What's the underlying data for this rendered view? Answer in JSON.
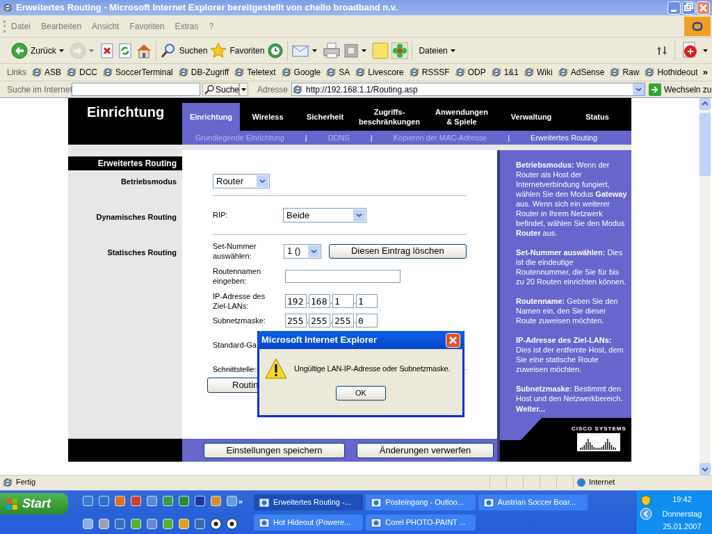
{
  "window": {
    "title": "Erweitertes Routing - Microsoft Internet Explorer bereitgestellt von chello broadband n.v."
  },
  "menu": [
    "Datei",
    "Bearbeiten",
    "Ansicht",
    "Favoriten",
    "Extras",
    "?"
  ],
  "toolbar_groups": [
    [
      {
        "kind": "back",
        "label": "Zurück",
        "dropdown": true,
        "disabled": false
      },
      {
        "kind": "forward",
        "dropdown": true,
        "disabled": true
      },
      {
        "kind": "stop",
        "dropdown": false,
        "disabled": false
      },
      {
        "kind": "refresh",
        "dropdown": false,
        "disabled": false
      },
      {
        "kind": "home",
        "dropdown": false,
        "disabled": false
      }
    ],
    [
      {
        "kind": "search",
        "label": "Suchen",
        "dropdown": false,
        "disabled": false
      },
      {
        "kind": "favorites",
        "label": "Favoriten",
        "dropdown": false,
        "disabled": false
      },
      {
        "kind": "history",
        "dropdown": false,
        "disabled": false
      }
    ],
    [
      {
        "kind": "mail",
        "dropdown": true,
        "disabled": false
      },
      {
        "kind": "print",
        "dropdown": false,
        "disabled": false
      },
      {
        "kind": "edit",
        "dropdown": true,
        "disabled": false
      },
      {
        "kind": "note",
        "dropdown": false,
        "disabled": false
      },
      {
        "kind": "flower",
        "dropdown": false,
        "disabled": false
      }
    ],
    [
      {
        "kind": "text",
        "label": "Dateien",
        "dropdown": true,
        "disabled": false
      }
    ]
  ],
  "toolbar_right": [
    {
      "kind": "sync",
      "dropdown": false,
      "disabled": false
    },
    {
      "kind": "pdf",
      "dropdown": true,
      "disabled": false
    }
  ],
  "links": {
    "label": "Links",
    "items": [
      "ASB",
      "DCC",
      "SoccerTerminal",
      "DB-Zugriff",
      "Teletext",
      "Google",
      "SA",
      "Livescore",
      "RSSSF",
      "ODP",
      "1&1",
      "Wiki",
      "AdSense",
      "Raw",
      "Hothideout"
    ],
    "more": "»"
  },
  "search_bar": {
    "label": "Suche im Internet",
    "button": "Suche"
  },
  "address": {
    "label": "Adresse",
    "url": "http://192.168.1.1/Routing.asp",
    "go": "Wechseln zu"
  },
  "router": {
    "section": "Einrichtung",
    "tabs": [
      {
        "label": "Einrichtung",
        "selected": true
      },
      {
        "label": "Wireless",
        "selected": false
      },
      {
        "label": "Sicherheit",
        "selected": false
      },
      {
        "label": "Zugriffs-beschränkungen",
        "selected": false
      },
      {
        "label": "Anwendungen & Spiele",
        "selected": false
      },
      {
        "label": "Verwaltung",
        "selected": false
      },
      {
        "label": "Status",
        "selected": false
      }
    ],
    "subtabs": [
      {
        "label": "Grundlegende Einrichtung",
        "selected": false
      },
      {
        "label": "DDNS",
        "selected": false
      },
      {
        "label": "Kopieren der MAC-Adresse",
        "selected": false
      },
      {
        "label": "Erweitertes Routing",
        "selected": true
      }
    ],
    "subtab_separator": "|",
    "page_title": "Erweitertes Routing",
    "mode": {
      "label": "Betriebsmodus",
      "value": "Router"
    },
    "dynamic": {
      "label": "Dynamisches Routing",
      "field": "RIP:",
      "value": "Beide"
    },
    "static": {
      "label": "Statisches Routing",
      "set_label": "Set-Nummer auswählen:",
      "set_value": "1 ()",
      "delete_button": "Diesen Eintrag löschen",
      "name_label": "Routennamen eingeben:",
      "ip_label": "IP-Adresse des Ziel-LANs:",
      "ip": [
        "192",
        "168",
        "1",
        "1"
      ],
      "mask_label": "Subnetzmaske:",
      "mask": [
        "255",
        "255",
        "255",
        "0"
      ],
      "octet_separator": ".",
      "gateway_label": "Standard-Ga",
      "interface_label": "Schnittstelle:"
    },
    "table_button": "Routin",
    "help": [
      "**Betriebsmodus:** Wenn der Router als Host der Internetverbindung fungiert, wählen Sie den Modus **Gateway** aus. Wenn sich ein weiterer Router in Ihrem Netzwerk befindet, wählen Sie den Modus **Router** aus.",
      "**Set-Nummer auswählen:** Dies ist die eindeutige Routennummer, die Sie für bis zu 20 Routen einrichten können.",
      "**Routenname:** Geben Sie den Namen ein, den Sie dieser Route zuweisen möchten.",
      "**IP-Adresse des Ziel-LANs:** Dies ist der entfernte Host, dem Sie eine statische Route zuweisen möchten.",
      "**Subnetzmaske:** Bestimmt den Host und den Netzwerkbereich."
    ],
    "help_more": "Weiter...",
    "logo": "CISCO SYSTEMS",
    "footer_buttons": [
      "Einstellungen speichern",
      "Änderungen verwerfen"
    ]
  },
  "dialog": {
    "title": "Microsoft Internet Explorer",
    "message": "Ungültige LAN-IP-Adresse oder Subnetzmaske.",
    "button": "OK"
  },
  "status_bar": {
    "text": "Fertig",
    "zone": "Internet"
  },
  "taskbar": {
    "start": "Start",
    "more": "»",
    "tasks": [
      {
        "label": "Erweitertes Routing -...",
        "selected": true
      },
      {
        "label": "Posteingang - Outloo...",
        "selected": false
      },
      {
        "label": "Austrian Soccer Boar...",
        "selected": false
      },
      {
        "label": "Hot Hideout (Powere...",
        "selected": false
      },
      {
        "label": "Corel PHOTO-PAINT ...",
        "selected": false
      }
    ],
    "time": "19:42",
    "day": "Donnerstag",
    "date": "25.01.2007"
  }
}
